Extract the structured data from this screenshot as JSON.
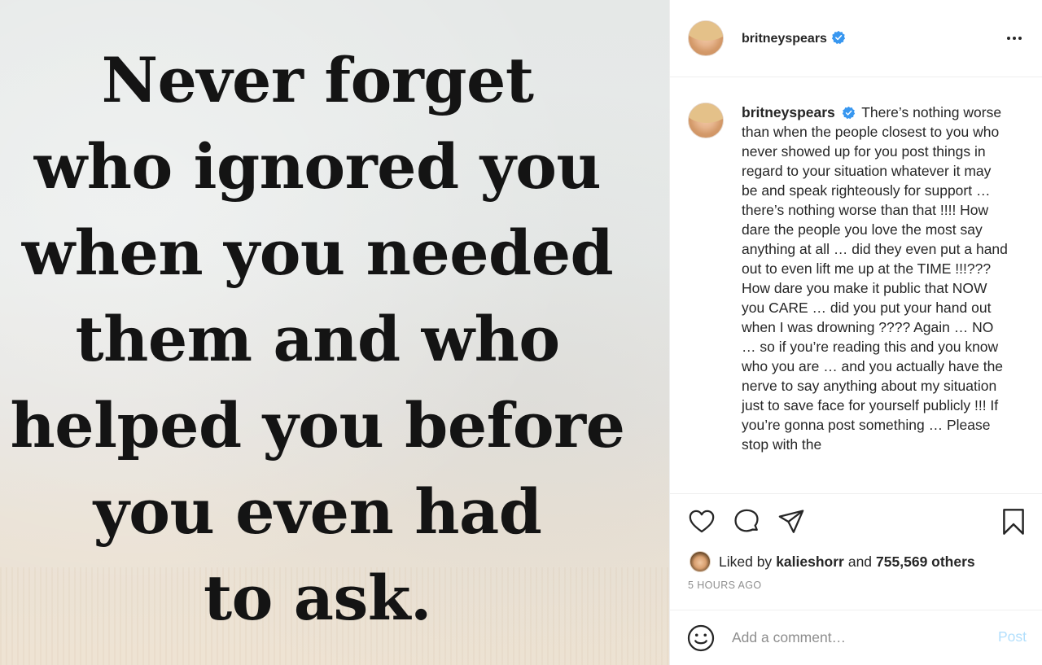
{
  "post": {
    "image_quote_lines": [
      "Never forget",
      "who ignored you",
      "when you needed",
      "them and who",
      "helped you before",
      "you even had",
      "to ask."
    ]
  },
  "header": {
    "username": "britneyspears",
    "verified_icon": "verified-badge-icon",
    "more_icon": "more-options-icon"
  },
  "caption": {
    "username": "britneyspears",
    "text": "There’s nothing worse than when the people closest to you who never showed up for you post things in regard to your situation whatever it may be and speak righteously for support … there’s nothing worse than that !!!! How dare the people you love the most say anything at all … did they even put a hand out to even lift me up at the TIME !!!??? How dare you make it public that NOW you CARE … did you put your hand out when I was drowning ???? Again … NO … so if you’re reading this and you know who you are … and you actually have the nerve to say anything about my situation just to save face for yourself publicly !!! If you’re gonna post something … Please stop with the"
  },
  "actions": {
    "like_icon": "heart-icon",
    "comment_icon": "comment-icon",
    "share_icon": "share-icon",
    "save_icon": "bookmark-icon"
  },
  "likes": {
    "prefix": "Liked by",
    "liker": "kalieshorr",
    "conjunction": "and",
    "others": "755,569 others"
  },
  "timestamp": "5 HOURS AGO",
  "comment": {
    "placeholder": "Add a comment…",
    "post_label": "Post",
    "emoji_icon": "smiley-icon"
  },
  "colors": {
    "verified_blue": "#3897f0",
    "post_button_disabled": "#b2dffc",
    "muted_text": "#8e8e8e"
  }
}
